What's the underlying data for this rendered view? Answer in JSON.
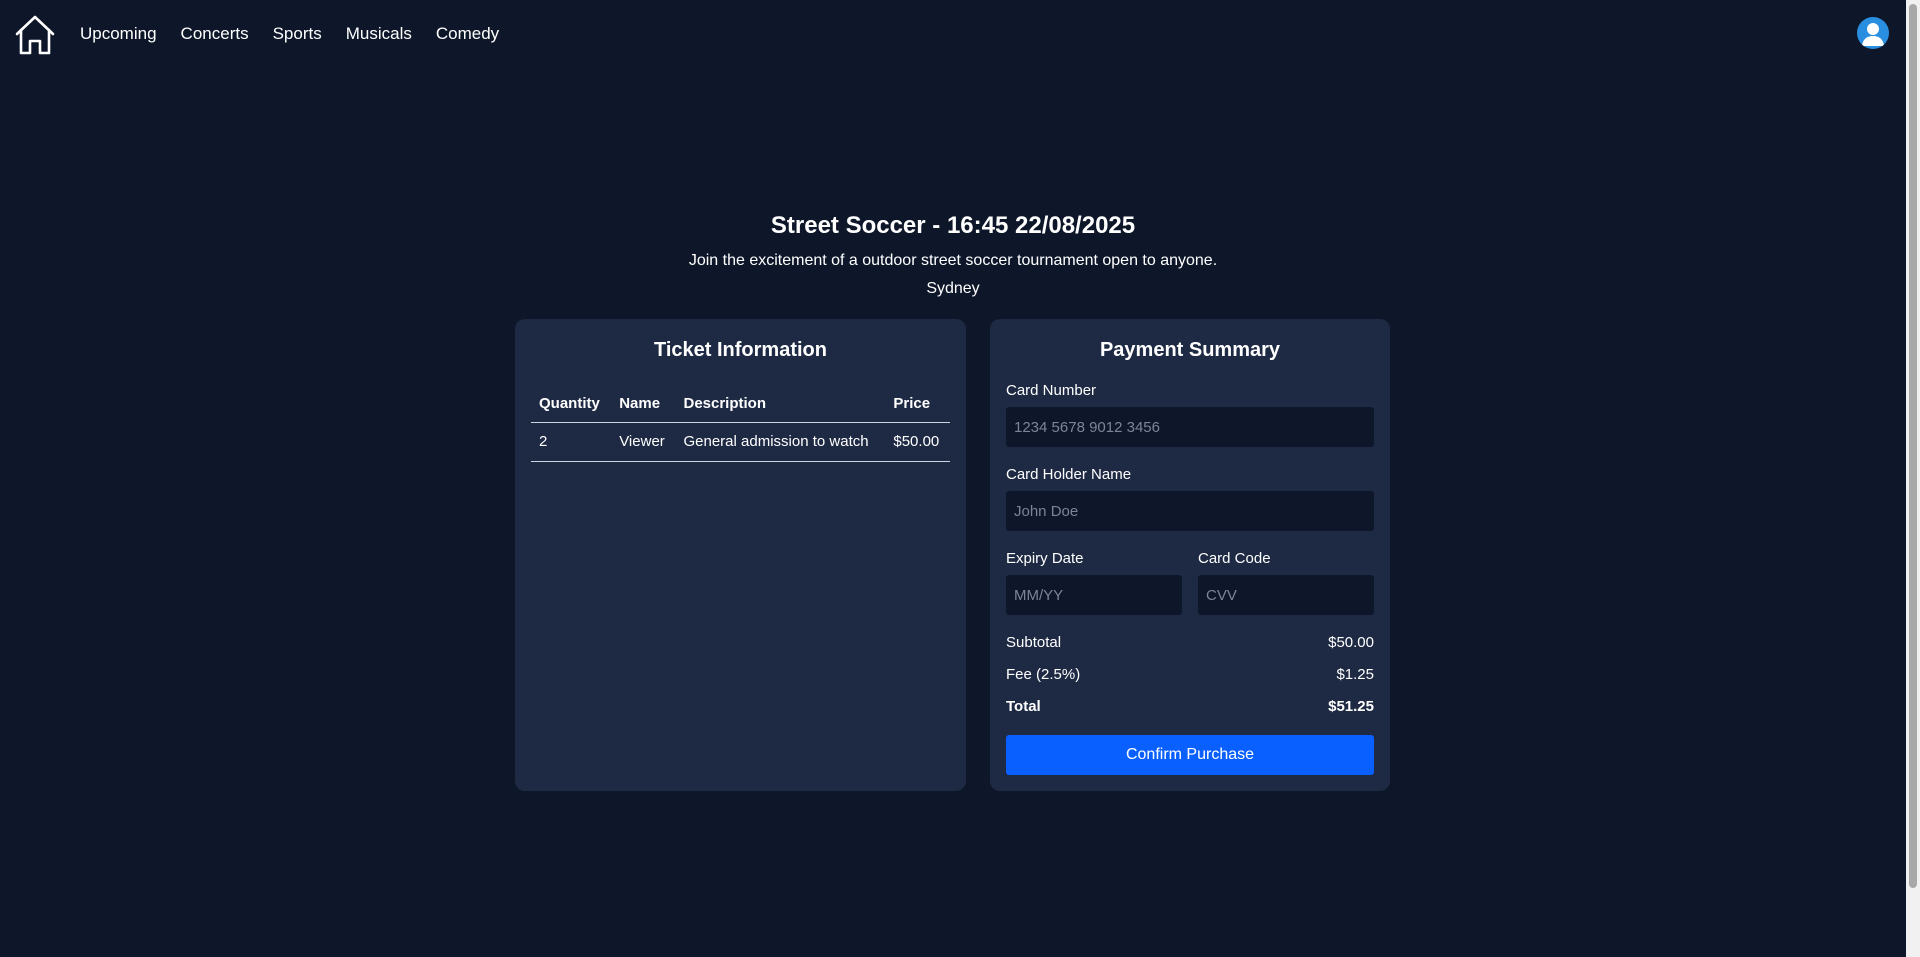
{
  "nav": {
    "home_icon": "home-icon",
    "links": [
      "Upcoming",
      "Concerts",
      "Sports",
      "Musicals",
      "Comedy"
    ],
    "avatar_icon": "user-avatar-icon"
  },
  "event": {
    "title": "Street Soccer - 16:45 22/08/2025",
    "description": "Join the excitement of a outdoor street soccer tournament open to anyone.",
    "location": "Sydney"
  },
  "ticket_info": {
    "title": "Ticket Information",
    "headers": [
      "Quantity",
      "Name",
      "Description",
      "Price"
    ],
    "rows": [
      [
        "2",
        "Viewer",
        "General admission to watch",
        "$50.00"
      ]
    ]
  },
  "payment": {
    "title": "Payment Summary",
    "card_number": {
      "label": "Card Number",
      "placeholder": "1234 5678 9012 3456",
      "value": ""
    },
    "card_holder": {
      "label": "Card Holder Name",
      "placeholder": "John Doe",
      "value": ""
    },
    "expiry": {
      "label": "Expiry Date",
      "placeholder": "MM/YY",
      "value": ""
    },
    "cvv": {
      "label": "Card Code",
      "placeholder": "CVV",
      "value": ""
    },
    "subtotal": {
      "label": "Subtotal",
      "value": "$50.00"
    },
    "fee": {
      "label": "Fee (2.5%)",
      "value": "$1.25"
    },
    "total": {
      "label": "Total",
      "value": "$51.25"
    },
    "confirm_label": "Confirm Purchase"
  },
  "colors": {
    "background": "#0e172a",
    "panel": "#1e2a44",
    "accent": "#0a60ff",
    "avatar": "#2a8ee0"
  }
}
